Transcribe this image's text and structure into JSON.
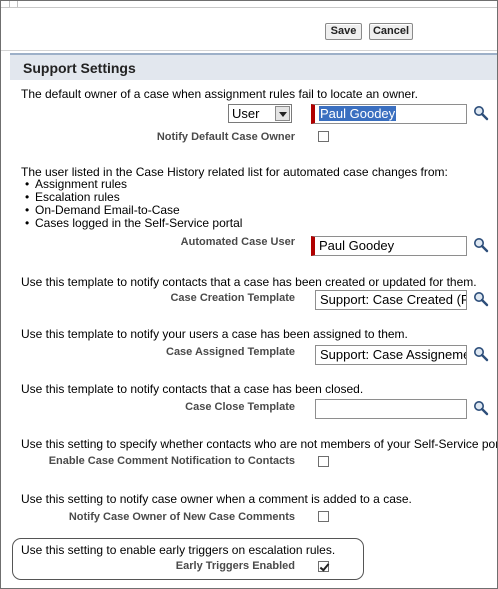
{
  "toolbar": {
    "save_label": "Save",
    "cancel_label": "Cancel"
  },
  "section": {
    "title": "Support Settings"
  },
  "default_owner": {
    "description": "The default owner of a case when assignment rules fail to locate an owner.",
    "type_select_value": "User",
    "owner_value": "Paul Goodey",
    "notify_label": "Notify Default Case Owner",
    "notify_checked": false
  },
  "automated_user": {
    "description": "The user listed in the Case History related list for automated case changes from:",
    "bullets": [
      "Assignment rules",
      "Escalation rules",
      "On-Demand Email-to-Case",
      "Cases logged in the Self-Service portal"
    ],
    "label": "Automated Case User",
    "value": "Paul Goodey"
  },
  "creation_template": {
    "description": "Use this template to notify contacts that a case has been created or updated for them.",
    "label": "Case Creation Template",
    "value": "Support: Case Created (F"
  },
  "assigned_template": {
    "description": "Use this template to notify your users a case has been assigned to them.",
    "label": "Case Assigned Template",
    "value": "Support: Case Assigneme"
  },
  "close_template": {
    "description": "Use this template to notify contacts that a case has been closed.",
    "label": "Case Close Template",
    "value": ""
  },
  "comment_notification": {
    "description": "Use this setting to specify whether contacts who are not members of your Self-Service por",
    "label": "Enable Case Comment Notification to Contacts",
    "checked": false
  },
  "owner_comment": {
    "description": "Use this setting to notify case owner when a comment is added to a case.",
    "label": "Notify Case Owner of New Case Comments",
    "checked": false
  },
  "early_triggers": {
    "description": "Use this setting to enable early triggers on escalation rules.",
    "label": "Early Triggers Enabled",
    "checked": true
  },
  "icons": {
    "lookup": "magnifier-lookup-icon",
    "dropdown": "chevron-down-icon"
  },
  "colors": {
    "required_bar": "#b00000",
    "selection": "#3a6fc0",
    "section_header_bg": "#e2e7ee"
  }
}
